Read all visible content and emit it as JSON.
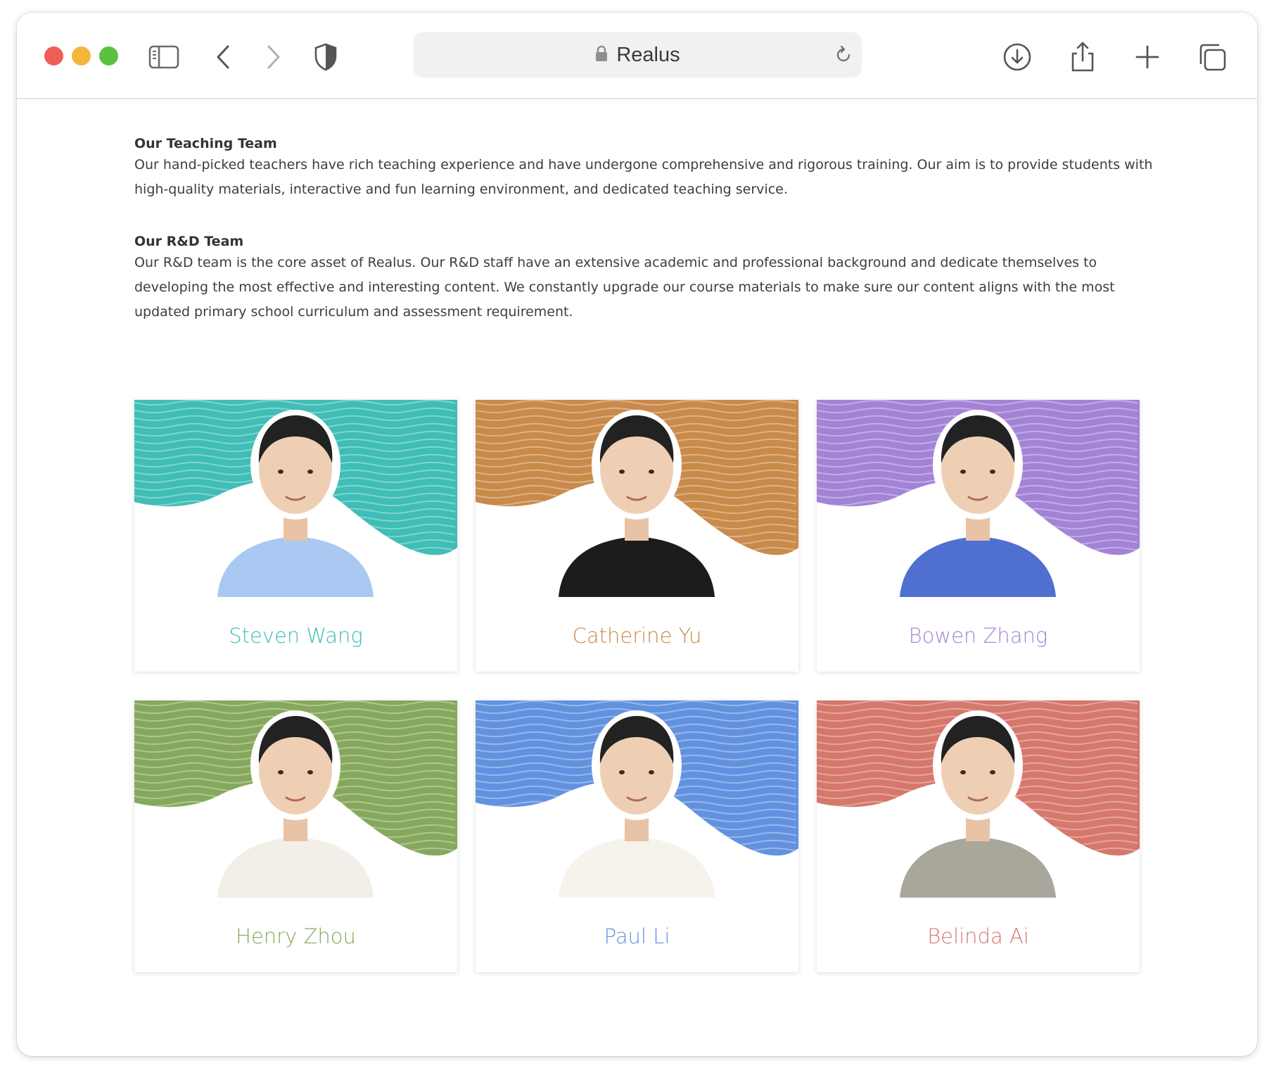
{
  "browser": {
    "address": "Realus"
  },
  "sections": {
    "teaching_title": "Our Teaching Team",
    "teaching_text": "Our hand-picked teachers have rich teaching experience and have undergone comprehensive and rigorous training. Our aim is to provide students with high-quality materials, interactive and fun learning environment, and dedicated teaching service.",
    "rd_title": "Our R&D Team",
    "rd_text": "Our R&D team is the core asset of Realus. Our R&D staff have an extensive academic and professional background and dedicate themselves to developing the most effective and interesting content. We constantly upgrade our course materials to make sure our content aligns with the most updated primary school curriculum and assessment requirement."
  },
  "team": [
    {
      "name": "Steven Wang",
      "color": "#3fbdb6",
      "shirt": "#a9c8f2"
    },
    {
      "name": "Catherine Yu",
      "color": "#c98a4a",
      "shirt": "#1c1c1c"
    },
    {
      "name": "Bowen Zhang",
      "color": "#a383d6",
      "shirt": "#4f6fd1"
    },
    {
      "name": "Henry Zhou",
      "color": "#86a85c",
      "shirt": "#f1efe8"
    },
    {
      "name": "Paul Li",
      "color": "#6292df",
      "shirt": "#f6f2ec"
    },
    {
      "name": "Belinda Ai",
      "color": "#d6776c",
      "shirt": "#a9a79c"
    }
  ]
}
